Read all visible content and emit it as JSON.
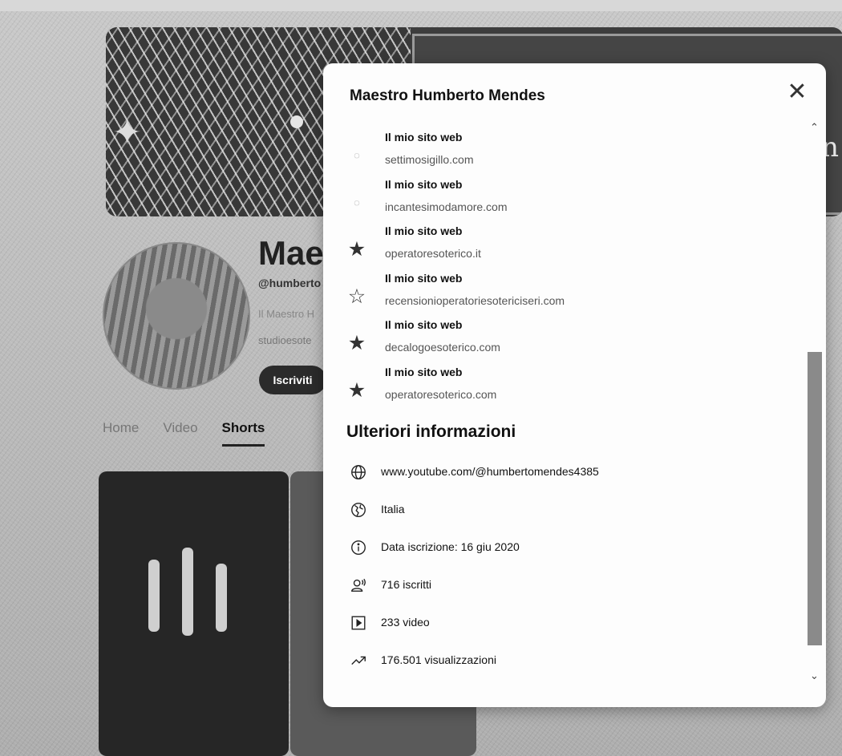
{
  "background": {
    "channel_name_partial": "Maes",
    "handle_partial": "@humberto",
    "description_partial": "Il Maestro H",
    "link_partial": "studioesote",
    "subscribe_label": "Iscriviti",
    "tabs": [
      {
        "label": "Home",
        "active": false
      },
      {
        "label": "Video",
        "active": false
      },
      {
        "label": "Shorts",
        "active": true
      }
    ]
  },
  "modal": {
    "title": "Maestro Humberto Mendes",
    "links": [
      {
        "label": "Il mio sito web",
        "url": "settimosigillo.com",
        "icon": "site-favicon-icon"
      },
      {
        "label": "Il mio sito web",
        "url": "incantesimodamore.com",
        "icon": "site-favicon-icon"
      },
      {
        "label": "Il mio sito web",
        "url": "operatoresoterico.it",
        "icon": "star-icon"
      },
      {
        "label": "Il mio sito web",
        "url": "recensionioperatoriesotericiseri.com",
        "icon": "star-outline-icon"
      },
      {
        "label": "Il mio sito web",
        "url": "decalogoesoterico.com",
        "icon": "star-icon"
      },
      {
        "label": "Il mio sito web",
        "url": "operatoresoterico.com",
        "icon": "star-icon"
      }
    ],
    "more_info_title": "Ulteriori informazioni",
    "details": [
      {
        "icon": "globe-icon",
        "text": "www.youtube.com/@humbertomendes4385"
      },
      {
        "icon": "location-globe-icon",
        "text": "Italia"
      },
      {
        "icon": "info-icon",
        "text": "Data iscrizione: 16 giu 2020"
      },
      {
        "icon": "subscribers-icon",
        "text": "716 iscritti"
      },
      {
        "icon": "video-icon",
        "text": "233 video"
      },
      {
        "icon": "trending-icon",
        "text": "176.501 visualizzazioni"
      }
    ]
  }
}
